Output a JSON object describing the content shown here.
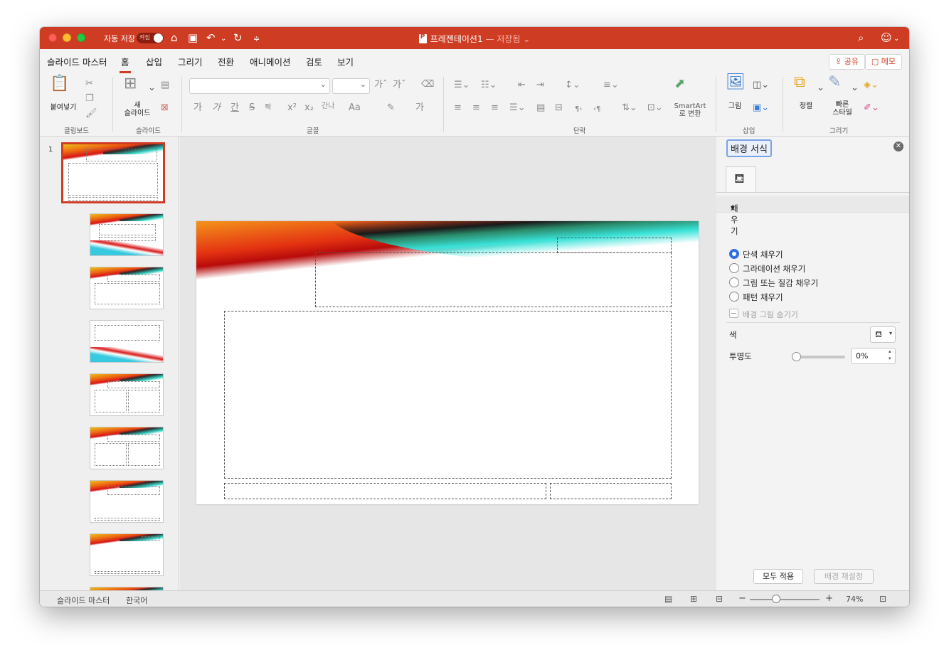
{
  "titlebar": {
    "autosave_label": "자동 저장",
    "autosave_state": "켜짐",
    "doc_title": "프레젠테이션1",
    "saved_status": "— 저장됨 ⌄"
  },
  "tabs": [
    {
      "label": "슬라이드 마스터"
    },
    {
      "label": "홈"
    },
    {
      "label": "삽입"
    },
    {
      "label": "그리기"
    },
    {
      "label": "전환"
    },
    {
      "label": "애니메이션"
    },
    {
      "label": "검토"
    },
    {
      "label": "보기"
    }
  ],
  "share_label": "공유",
  "memo_label": "메모",
  "ribbon": {
    "paste_label": "붙여넣기",
    "new_slide_label_1": "새",
    "new_slide_label_2": "슬라이드",
    "smartart_label_1": "SmartArt",
    "smartart_label_2": "로 변환",
    "picture_label": "그림",
    "arrange_label": "정렬",
    "quick_style_label_1": "빠른",
    "quick_style_label_2": "스타일",
    "groups": {
      "clipboard": "클립보드",
      "slide": "슬라이드",
      "font": "글꼴",
      "paragraph": "단락",
      "insert": "삽입",
      "drawing": "그리기"
    },
    "font_buttons": [
      "가",
      "가",
      "간",
      "S",
      "짝",
      "x²",
      "x₂",
      "간나",
      "Aa",
      "가"
    ],
    "grow_font": "가ˆ",
    "shrink_font": "가ˇ"
  },
  "thumb_number": "1",
  "pane": {
    "title": "배경 서식",
    "section": "채우기",
    "fill_options": [
      "단색 채우기",
      "그라데이션 채우기",
      "그림 또는 질감 채우기",
      "패턴 채우기"
    ],
    "hide_bg_label": "배경 그림 숨기기",
    "color_label": "색",
    "transparency_label": "투명도",
    "transparency_value": "0%",
    "apply_all_label": "모두 적용",
    "reset_bg_label": "배경 재설정"
  },
  "status": {
    "view_name": "슬라이드 마스터",
    "language": "한국어",
    "zoom_value": "74%",
    "zoom_minus": "−",
    "zoom_plus": "+"
  },
  "colors": {
    "accent": "#cf3c24",
    "selection_blue": "#2f6fe4"
  }
}
